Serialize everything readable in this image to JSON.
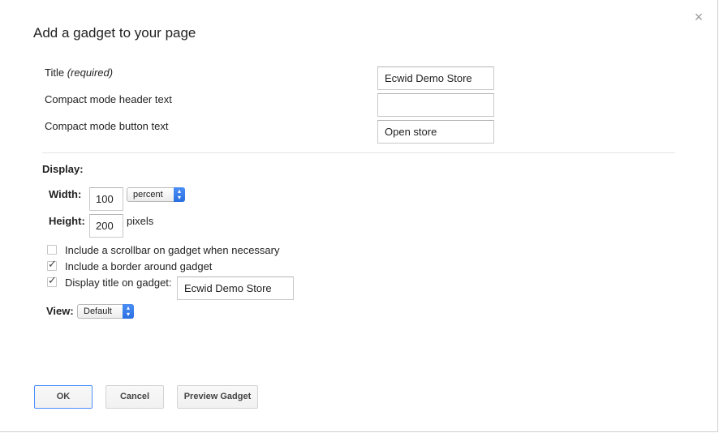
{
  "dialog": {
    "title": "Add a gadget to your page",
    "close_glyph": "×"
  },
  "fields": {
    "title_label": "Title",
    "title_required": "(required)",
    "title_value": "Ecwid Demo Store",
    "header_label": "Compact mode header text",
    "header_value": "",
    "button_label": "Compact mode button text",
    "button_value": "Open store"
  },
  "display": {
    "heading": "Display:",
    "width_label": "Width:",
    "width_value": "100",
    "width_unit": "percent",
    "height_label": "Height:",
    "height_value": "200",
    "height_unit": "pixels",
    "scrollbar_label": "Include a scrollbar on gadget when necessary",
    "scrollbar_checked": false,
    "border_label": "Include a border around gadget",
    "border_checked": true,
    "show_title_label": "Display title on gadget:",
    "show_title_checked": true,
    "show_title_value": "Ecwid Demo Store",
    "view_label": "View:",
    "view_value": "Default"
  },
  "buttons": {
    "ok": "OK",
    "cancel": "Cancel",
    "preview": "Preview Gadget"
  },
  "colors": {
    "primary_border": "#4d90fe",
    "select_arrow": "#2a6fe0"
  }
}
